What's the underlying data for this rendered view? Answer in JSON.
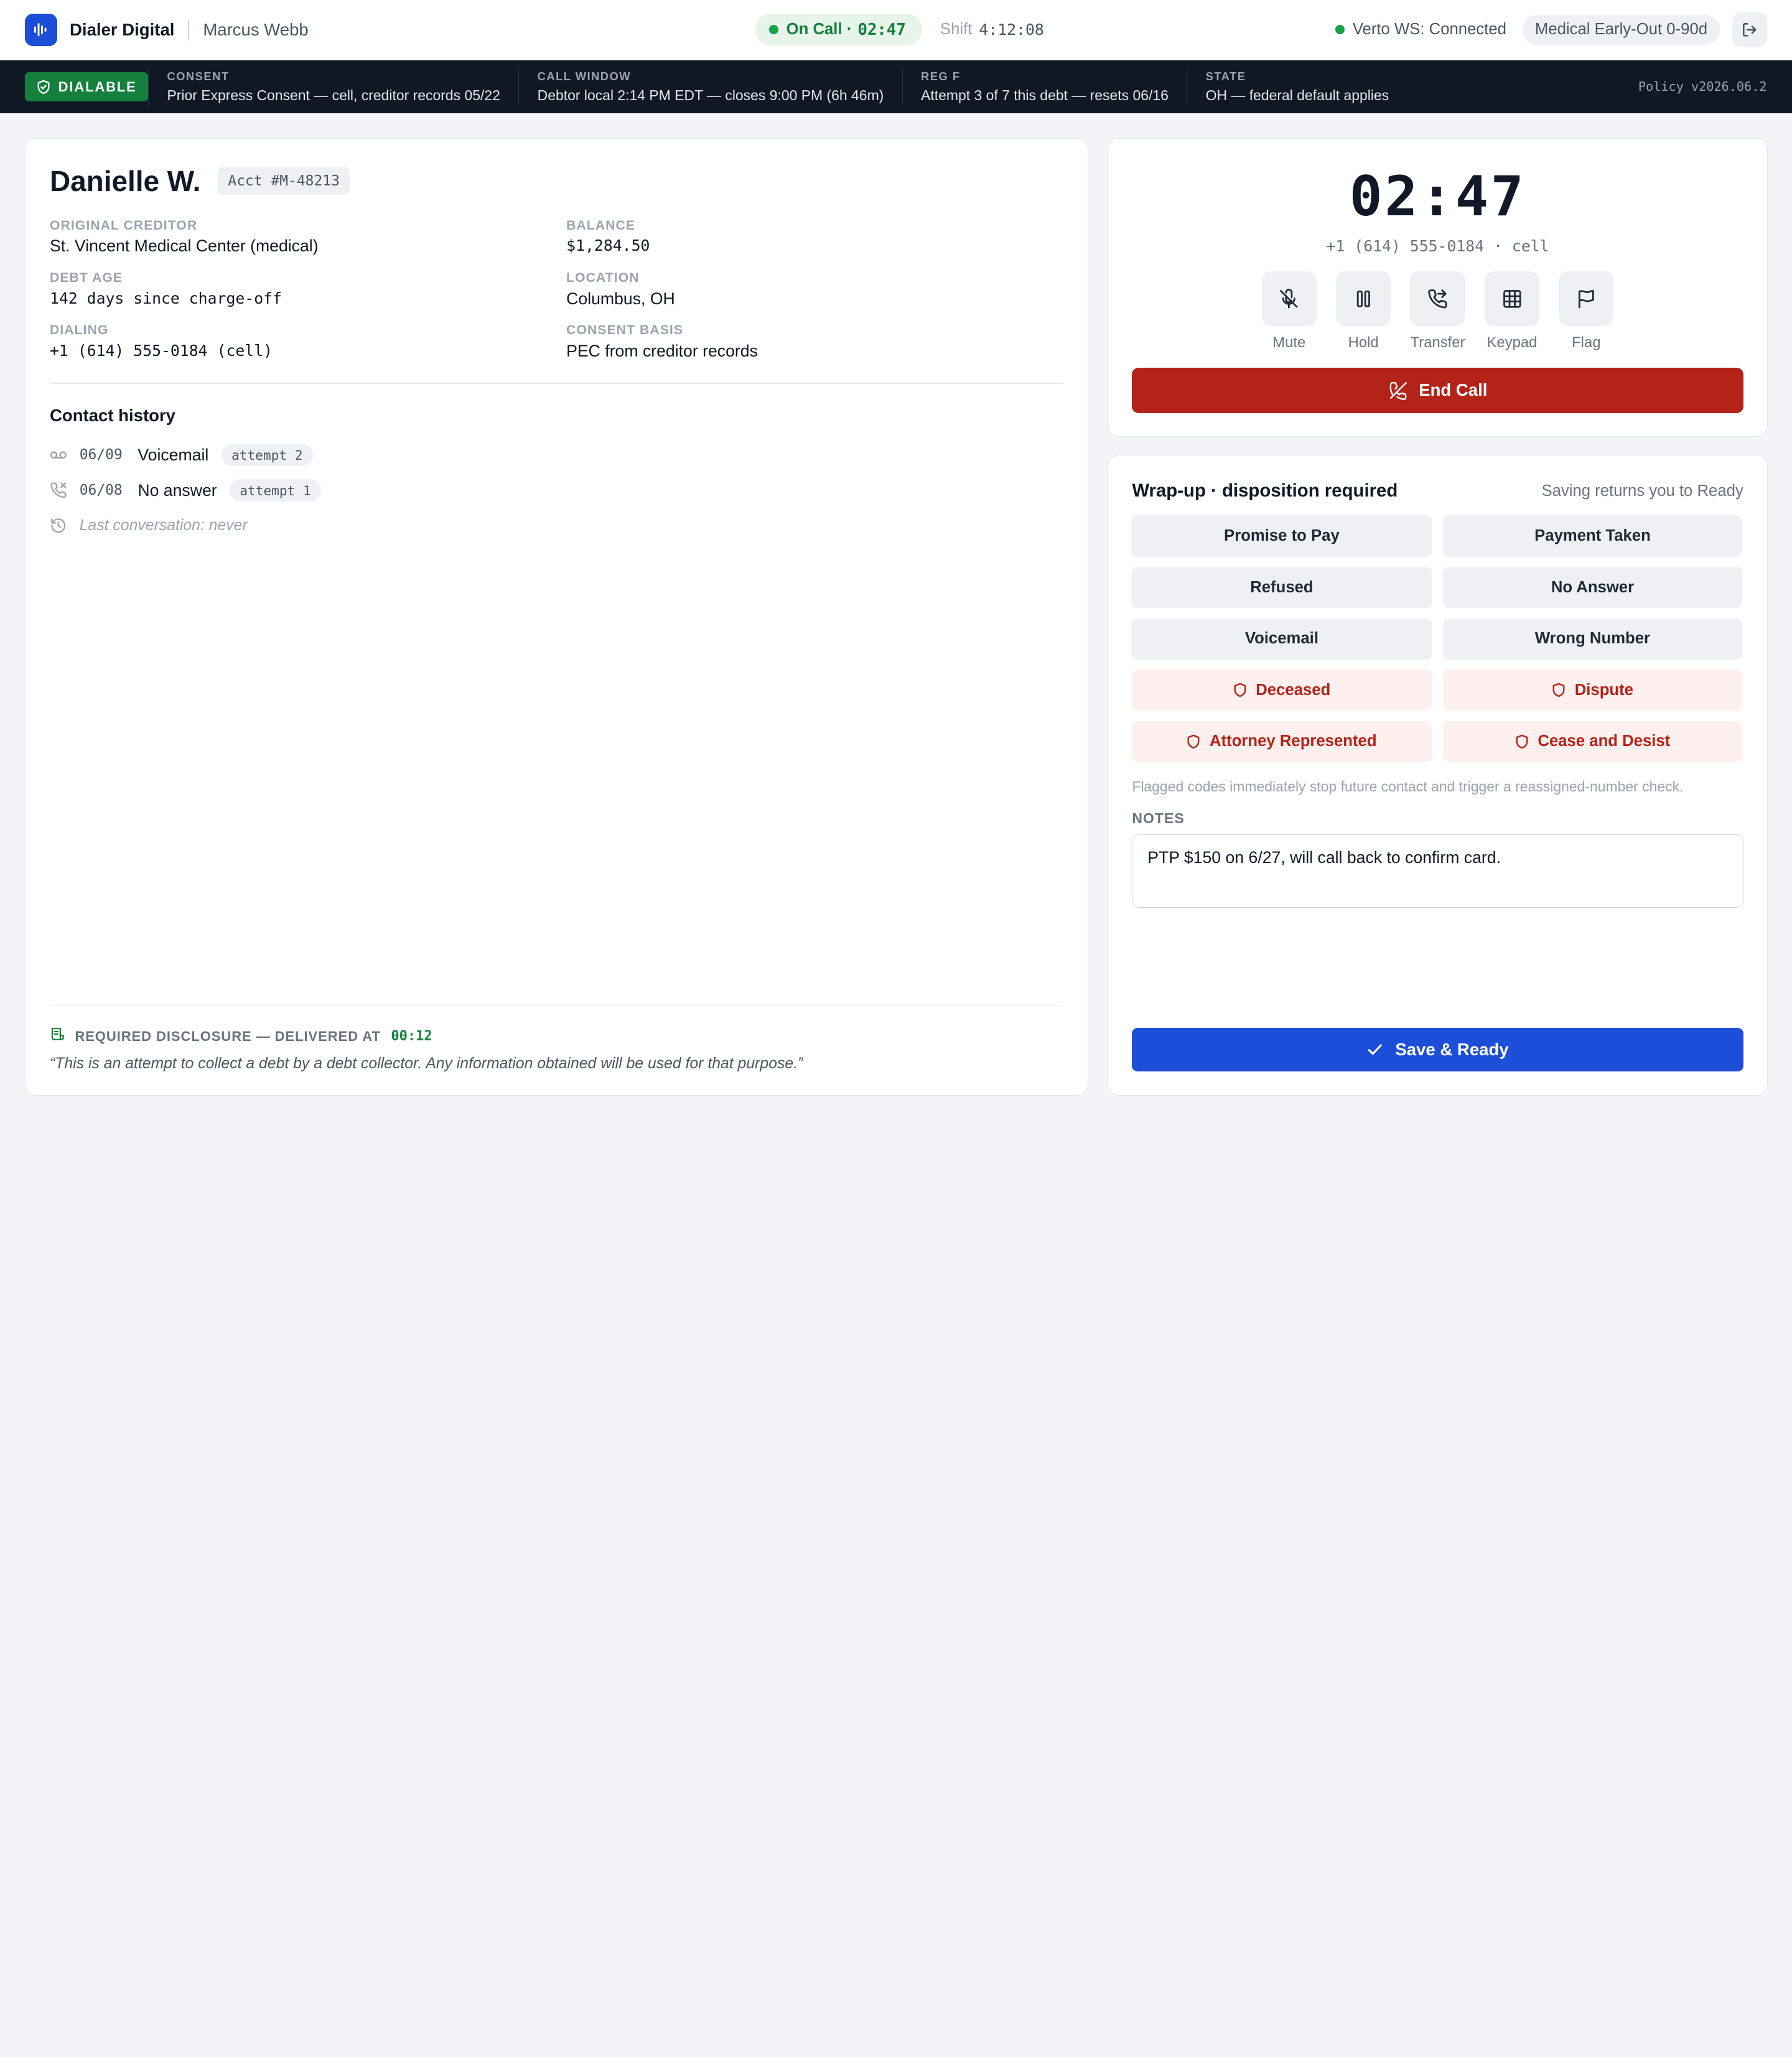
{
  "app": {
    "name": "Dialer Digital",
    "agent": "Marcus Webb",
    "status_label": "On Call ·",
    "status_time": "02:47",
    "shift_label": "Shift",
    "shift_time": "4:12:08",
    "ws_status": "Verto WS: Connected",
    "campaign": "Medical Early-Out 0-90d",
    "icons": {
      "logo": "waveform-icon",
      "logout": "logout-icon"
    },
    "colors": {
      "brand": "#1d4ed8",
      "success": "#15803d",
      "danger": "#b42318"
    }
  },
  "compliance": {
    "badge": "DIALABLE",
    "items": [
      {
        "label": "CONSENT",
        "value": "Prior Express Consent — cell, creditor records 05/22"
      },
      {
        "label": "CALL WINDOW",
        "value": "Debtor local 2:14 PM EDT — closes 9:00 PM (6h 46m)"
      },
      {
        "label": "REG F",
        "value": "Attempt 3 of 7 this debt — resets 06/16"
      },
      {
        "label": "STATE",
        "value": "OH — federal default applies"
      }
    ],
    "policy": "Policy v2026.06.2"
  },
  "debtor": {
    "name": "Danielle W.",
    "account": "Acct #M-48213",
    "fields": {
      "original_creditor": {
        "label": "ORIGINAL CREDITOR",
        "value": "St. Vincent Medical Center (medical)"
      },
      "balance": {
        "label": "BALANCE",
        "value": "$1,284.50"
      },
      "debt_age": {
        "label": "DEBT AGE",
        "value": "142 days since charge-off"
      },
      "location": {
        "label": "LOCATION",
        "value": "Columbus, OH"
      },
      "dialing": {
        "label": "DIALING",
        "value": "+1 (614) 555-0184 (cell)"
      },
      "consent_basis": {
        "label": "CONSENT BASIS",
        "value": "PEC from creditor records"
      }
    }
  },
  "history": {
    "title": "Contact history",
    "items": [
      {
        "date": "06/09",
        "type": "Voicemail",
        "attempt": "attempt 2",
        "icon": "voicemail-icon"
      },
      {
        "date": "06/08",
        "type": "No answer",
        "attempt": "attempt 1",
        "icon": "phone-missed-icon"
      }
    ],
    "last": "Last conversation: never",
    "last_icon": "history-icon"
  },
  "disclosure": {
    "label": "REQUIRED DISCLOSURE — DELIVERED AT",
    "time": "00:12",
    "text": "“This is an attempt to collect a debt by a debt collector. Any information obtained will be used for that purpose.”",
    "icon": "script-icon"
  },
  "call": {
    "timer": "02:47",
    "number": "+1 (614) 555-0184 · cell",
    "controls": {
      "mute": "Mute",
      "hold": "Hold",
      "transfer": "Transfer",
      "keypad": "Keypad",
      "flag": "Flag"
    },
    "end_label": "End Call"
  },
  "wrapup": {
    "title": "Wrap-up · disposition required",
    "hint": "Saving returns you to Ready",
    "dispositions": {
      "promise": "Promise to Pay",
      "payment": "Payment Taken",
      "refused": "Refused",
      "no_answer": "No Answer",
      "voicemail": "Voicemail",
      "wrong_number": "Wrong Number",
      "deceased": "Deceased",
      "dispute": "Dispute",
      "attorney": "Attorney Represented",
      "cease": "Cease and Desist"
    },
    "flag_note": "Flagged codes immediately stop future contact and trigger a reassigned-number check.",
    "notes_label": "NOTES",
    "notes_value": "PTP $150 on 6/27, will call back to confirm card.",
    "save_label": "Save & Ready"
  }
}
